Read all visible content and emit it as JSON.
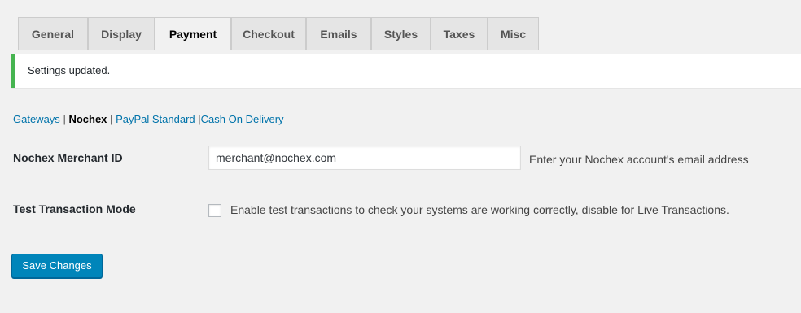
{
  "tabs": [
    {
      "label": "General",
      "active": false
    },
    {
      "label": "Display",
      "active": false
    },
    {
      "label": "Payment",
      "active": true
    },
    {
      "label": "Checkout",
      "active": false
    },
    {
      "label": "Emails",
      "active": false
    },
    {
      "label": "Styles",
      "active": false
    },
    {
      "label": "Taxes",
      "active": false
    },
    {
      "label": "Misc",
      "active": false
    }
  ],
  "notice": {
    "text": "Settings updated.",
    "border_color": "#46b450"
  },
  "subnav": {
    "items": [
      {
        "label": "Gateways",
        "current": false
      },
      {
        "label": "Nochex",
        "current": true
      },
      {
        "label": "PayPal Standard",
        "current": false
      },
      {
        "label": "Cash On Delivery",
        "current": false
      }
    ],
    "separator": "|"
  },
  "fields": {
    "merchant_id": {
      "label": "Nochex Merchant ID",
      "value": "merchant@nochex.com",
      "description": "Enter your Nochex account's email address"
    },
    "test_mode": {
      "label": "Test Transaction Mode",
      "checked": false,
      "description": "Enable test transactions to check your systems are working correctly, disable for Live Transactions."
    }
  },
  "save_button": {
    "label": "Save Changes",
    "color": "#0085ba"
  }
}
